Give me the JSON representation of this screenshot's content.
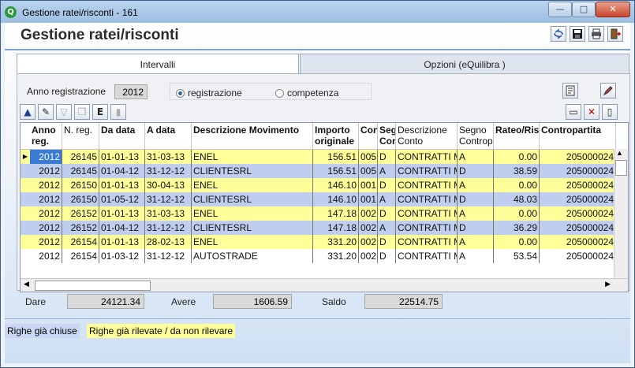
{
  "window": {
    "title": "Gestione ratei/risconti - 161",
    "minimize_glyph": "—",
    "maximize_glyph": "□",
    "close_glyph": "✕"
  },
  "heading": "Gestione ratei/risconti",
  "header_icons": [
    "refresh-icon",
    "save-icon",
    "print-icon",
    "exit-door-icon"
  ],
  "tabs": [
    {
      "label": "Intervalli",
      "active": true
    },
    {
      "label": "Opzioni (eQuilibra )",
      "active": false
    }
  ],
  "filters": {
    "anno_label": "Anno registrazione",
    "anno_value": "2012",
    "radio_registrazione": "registrazione",
    "radio_competenza": "competenza",
    "selected": "registrazione"
  },
  "grid": {
    "columns": [
      {
        "label": "Anno reg."
      },
      {
        "label": "N. reg."
      },
      {
        "label": "Da data"
      },
      {
        "label": "A data"
      },
      {
        "label": "Descrizione Movimento"
      },
      {
        "label": "Importo originale"
      },
      {
        "label": "Conto"
      },
      {
        "label": "Segno Conto"
      },
      {
        "label": "Descrizione Conto"
      },
      {
        "label": "Segno Contropartita"
      },
      {
        "label": "Rateo/Risconto"
      },
      {
        "label": "Contropartita"
      }
    ],
    "rows": [
      {
        "color": "y",
        "current": true,
        "anno": "2012",
        "nreg": "26145",
        "da": "01-01-13",
        "a": "31-03-13",
        "desc": "ENEL",
        "importo": "156.51",
        "conto": "005",
        "segno": "D",
        "descconto": "CONTRATTI MANUTENZIONE",
        "segnocp": "A",
        "rateo": "0.00",
        "cp": "205000024"
      },
      {
        "color": "b",
        "current": false,
        "anno": "2012",
        "nreg": "26145",
        "da": "01-04-12",
        "a": "31-12-12",
        "desc": "CLIENTESRL",
        "importo": "156.51",
        "conto": "005",
        "segno": "A",
        "descconto": "CONTRATTI MANUTENZIONE",
        "segnocp": "D",
        "rateo": "38.59",
        "cp": "205000024"
      },
      {
        "color": "y",
        "current": false,
        "anno": "2012",
        "nreg": "26150",
        "da": "01-01-13",
        "a": "30-04-13",
        "desc": "ENEL",
        "importo": "146.10",
        "conto": "001",
        "segno": "D",
        "descconto": "CONTRATTI MANUTENZIONE",
        "segnocp": "A",
        "rateo": "0.00",
        "cp": "205000024"
      },
      {
        "color": "b",
        "current": false,
        "anno": "2012",
        "nreg": "26150",
        "da": "01-05-12",
        "a": "31-12-12",
        "desc": "CLIENTESRL",
        "importo": "146.10",
        "conto": "001",
        "segno": "A",
        "descconto": "CONTRATTI MANUTENZIONE",
        "segnocp": "D",
        "rateo": "48.03",
        "cp": "205000024"
      },
      {
        "color": "y",
        "current": false,
        "anno": "2012",
        "nreg": "26152",
        "da": "01-01-13",
        "a": "31-03-13",
        "desc": "ENEL",
        "importo": "147.18",
        "conto": "002",
        "segno": "D",
        "descconto": "CONTRATTI MANUTENZIONE",
        "segnocp": "A",
        "rateo": "0.00",
        "cp": "205000024"
      },
      {
        "color": "b",
        "current": false,
        "anno": "2012",
        "nreg": "26152",
        "da": "01-04-12",
        "a": "31-12-12",
        "desc": "CLIENTESRL",
        "importo": "147.18",
        "conto": "002",
        "segno": "A",
        "descconto": "CONTRATTI MANUTENZIONE",
        "segnocp": "D",
        "rateo": "36.29",
        "cp": "205000024"
      },
      {
        "color": "y",
        "current": false,
        "anno": "2012",
        "nreg": "26154",
        "da": "01-01-13",
        "a": "28-02-13",
        "desc": "ENEL",
        "importo": "331.20",
        "conto": "002",
        "segno": "D",
        "descconto": "CONTRATTI MANUTENZIONE",
        "segnocp": "A",
        "rateo": "0.00",
        "cp": "205000024"
      },
      {
        "color": "w",
        "current": false,
        "anno": "2012",
        "nreg": "26154",
        "da": "01-03-12",
        "a": "31-12-12",
        "desc": "AUTOSTRADE",
        "importo": "331.20",
        "conto": "002",
        "segno": "D",
        "descconto": "CONTRATTI MANUTENZIONE",
        "segnocp": "A",
        "rateo": "53.54",
        "cp": "205000024"
      }
    ]
  },
  "totals": {
    "dare_label": "Dare",
    "dare_value": "24121.34",
    "avere_label": "Avere",
    "avere_value": "1606.59",
    "saldo_label": "Saldo",
    "saldo_value": "22514.75"
  },
  "legend": {
    "closed": "Righe già chiuse",
    "detected": "Righe già rilevate / da non rilevare"
  },
  "colors": {
    "yellow_row": "#ffff99",
    "blue_row": "#bfcdef",
    "legend_closed_bg": "#c9d7f5",
    "legend_detected_bg": "#ffff99"
  }
}
